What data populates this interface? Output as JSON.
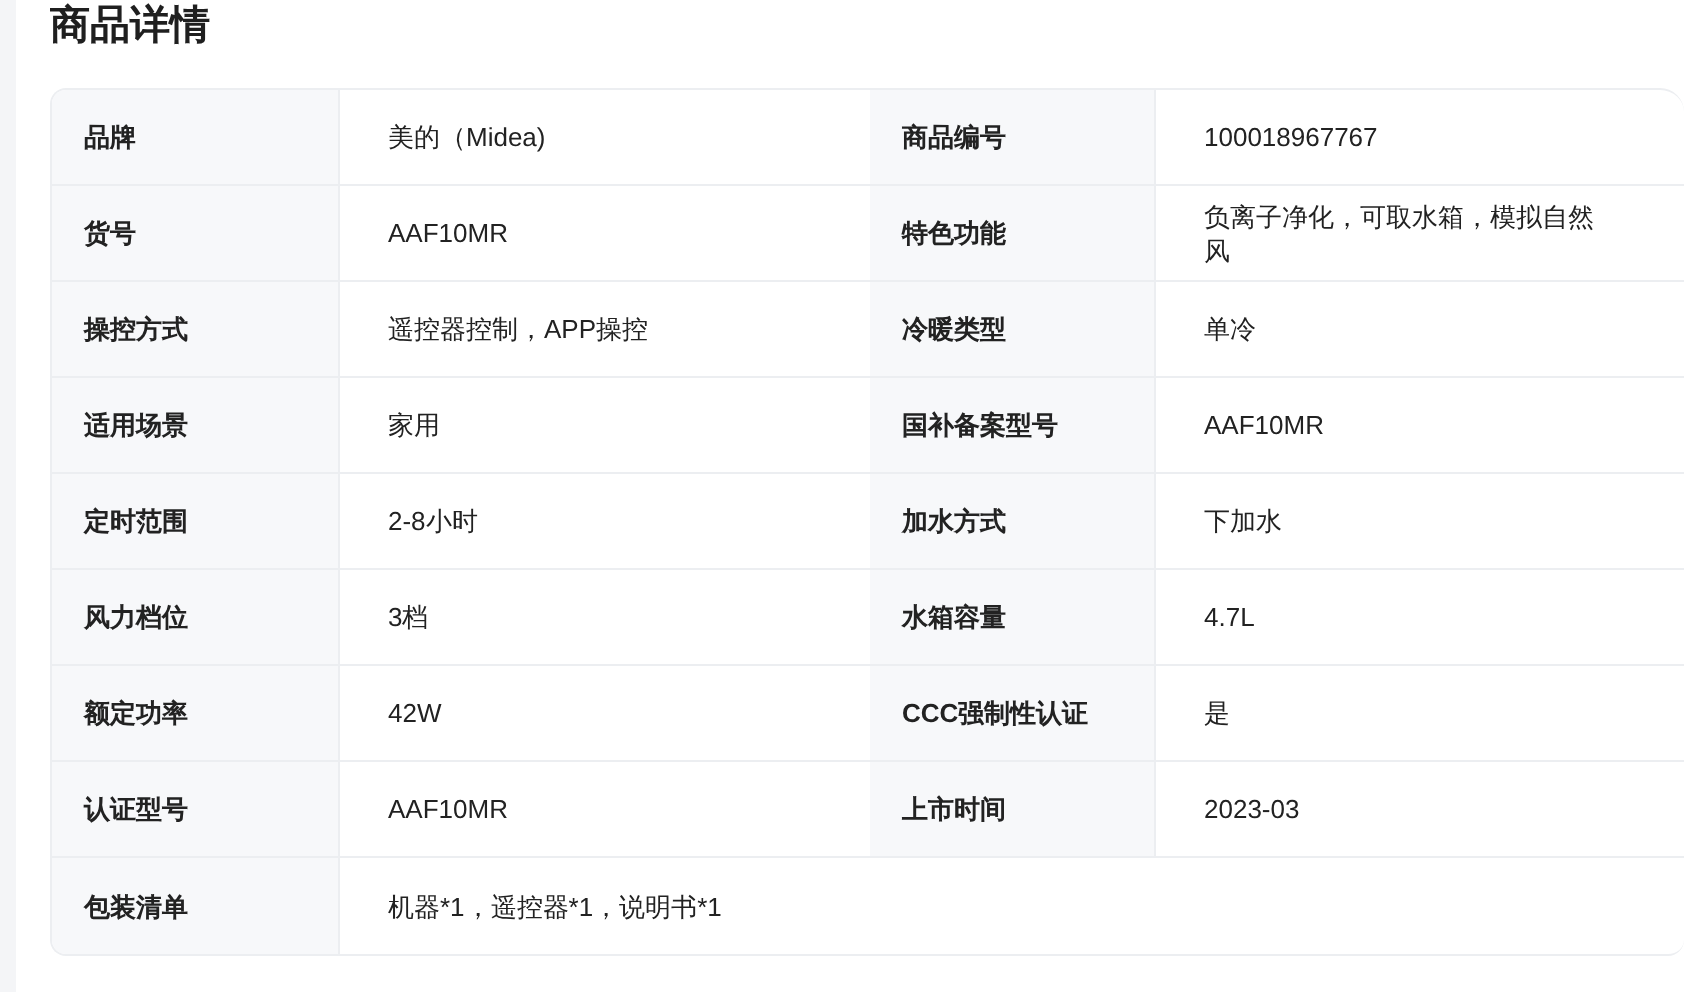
{
  "title": "商品详情",
  "rows": [
    [
      {
        "label": "品牌",
        "value": "美的（Midea)"
      },
      {
        "label": "商品编号",
        "value": "100018967767"
      }
    ],
    [
      {
        "label": "货号",
        "value": "AAF10MR"
      },
      {
        "label": "特色功能",
        "value": "负离子净化，可取水箱，模拟自然风"
      }
    ],
    [
      {
        "label": "操控方式",
        "value": "遥控器控制，APP操控"
      },
      {
        "label": "冷暖类型",
        "value": "单冷"
      }
    ],
    [
      {
        "label": "适用场景",
        "value": "家用"
      },
      {
        "label": "国补备案型号",
        "value": "AAF10MR"
      }
    ],
    [
      {
        "label": "定时范围",
        "value": "2-8小时"
      },
      {
        "label": "加水方式",
        "value": "下加水"
      }
    ],
    [
      {
        "label": "风力档位",
        "value": "3档"
      },
      {
        "label": "水箱容量",
        "value": "4.7L"
      }
    ],
    [
      {
        "label": "额定功率",
        "value": "42W"
      },
      {
        "label": "CCC强制性认证",
        "value": "是"
      }
    ],
    [
      {
        "label": "认证型号",
        "value": "AAF10MR"
      },
      {
        "label": "上市时间",
        "value": "2023-03"
      }
    ],
    [
      {
        "label": "包装清单",
        "value": "机器*1，遥控器*1，说明书*1"
      }
    ]
  ]
}
